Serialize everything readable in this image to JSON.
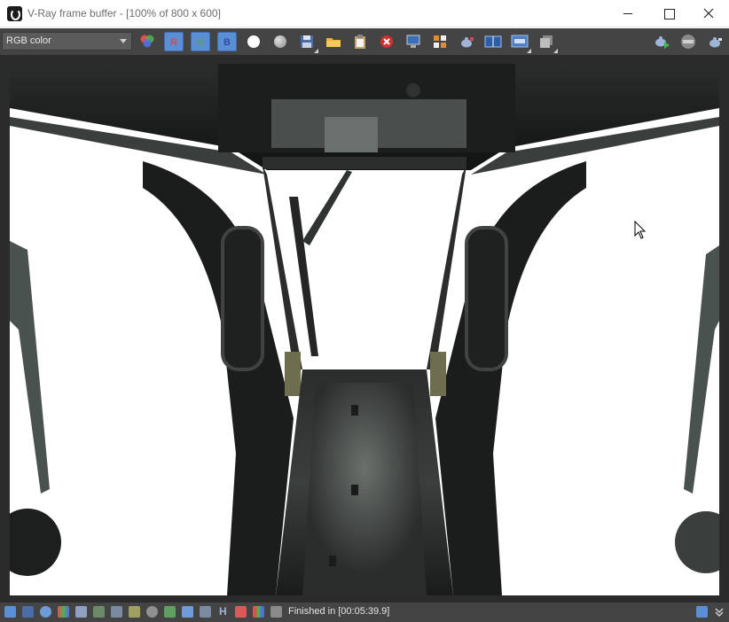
{
  "window": {
    "title": "V-Ray frame buffer - [100% of 800 x 600]"
  },
  "toolbar": {
    "channel_select": "RGB color",
    "channel_r": "R",
    "channel_g": "G",
    "channel_b": "B"
  },
  "statusbar": {
    "status_text": "Finished in [00:05:39.9]",
    "h_label": "H"
  },
  "colors": {
    "toolbar_bg": "#444444",
    "render_bg": "#2b2b2b",
    "channel_button": "#5a8fd6"
  }
}
